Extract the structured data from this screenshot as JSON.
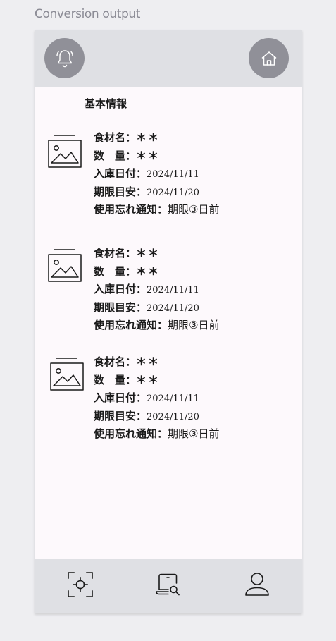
{
  "frame": {
    "label": "Conversion output"
  },
  "header": {
    "left_icon": "bell-icon",
    "right_icon": "home-icon"
  },
  "main": {
    "section_title": "基本情報",
    "items": [
      {
        "image_icon": "image-placeholder-icon",
        "name_label": "食材名：",
        "name_value": "＊＊",
        "qty_label": "数　量：",
        "qty_value": "＊＊",
        "in_date_label": "入庫日付：",
        "in_date_value": "2024/11/11",
        "limit_label": "期限目安：",
        "limit_value": "2024/11/20",
        "notify_label": "使用忘れ通知：",
        "notify_value": "期限③日前"
      },
      {
        "image_icon": "image-placeholder-icon",
        "name_label": "食材名：",
        "name_value": "＊＊",
        "qty_label": "数　量：",
        "qty_value": "＊＊",
        "in_date_label": "入庫日付：",
        "in_date_value": "2024/11/11",
        "limit_label": "期限目安：",
        "limit_value": "2024/11/20",
        "notify_label": "使用忘れ通知：",
        "notify_value": "期限③日前"
      },
      {
        "image_icon": "image-placeholder-icon",
        "name_label": "食材名：",
        "name_value": "＊＊",
        "qty_label": "数　量：",
        "qty_value": "＊＊",
        "in_date_label": "入庫日付：",
        "in_date_value": "2024/11/11",
        "limit_label": "期限目安：",
        "limit_value": "2024/11/20",
        "notify_label": "使用忘れ通知：",
        "notify_value": "期限③日前"
      }
    ]
  },
  "bottom_nav": {
    "items": [
      {
        "icon": "scan-focus-icon"
      },
      {
        "icon": "laptop-search-icon"
      },
      {
        "icon": "user-icon"
      }
    ]
  },
  "colors": {
    "page_background": "#eeeef1",
    "screen_background": "#fdf9fc",
    "bar_background": "#dfe0e4",
    "circle_button": "#909098",
    "text": "#1a1a1a",
    "frame_label": "#8a8a94"
  }
}
